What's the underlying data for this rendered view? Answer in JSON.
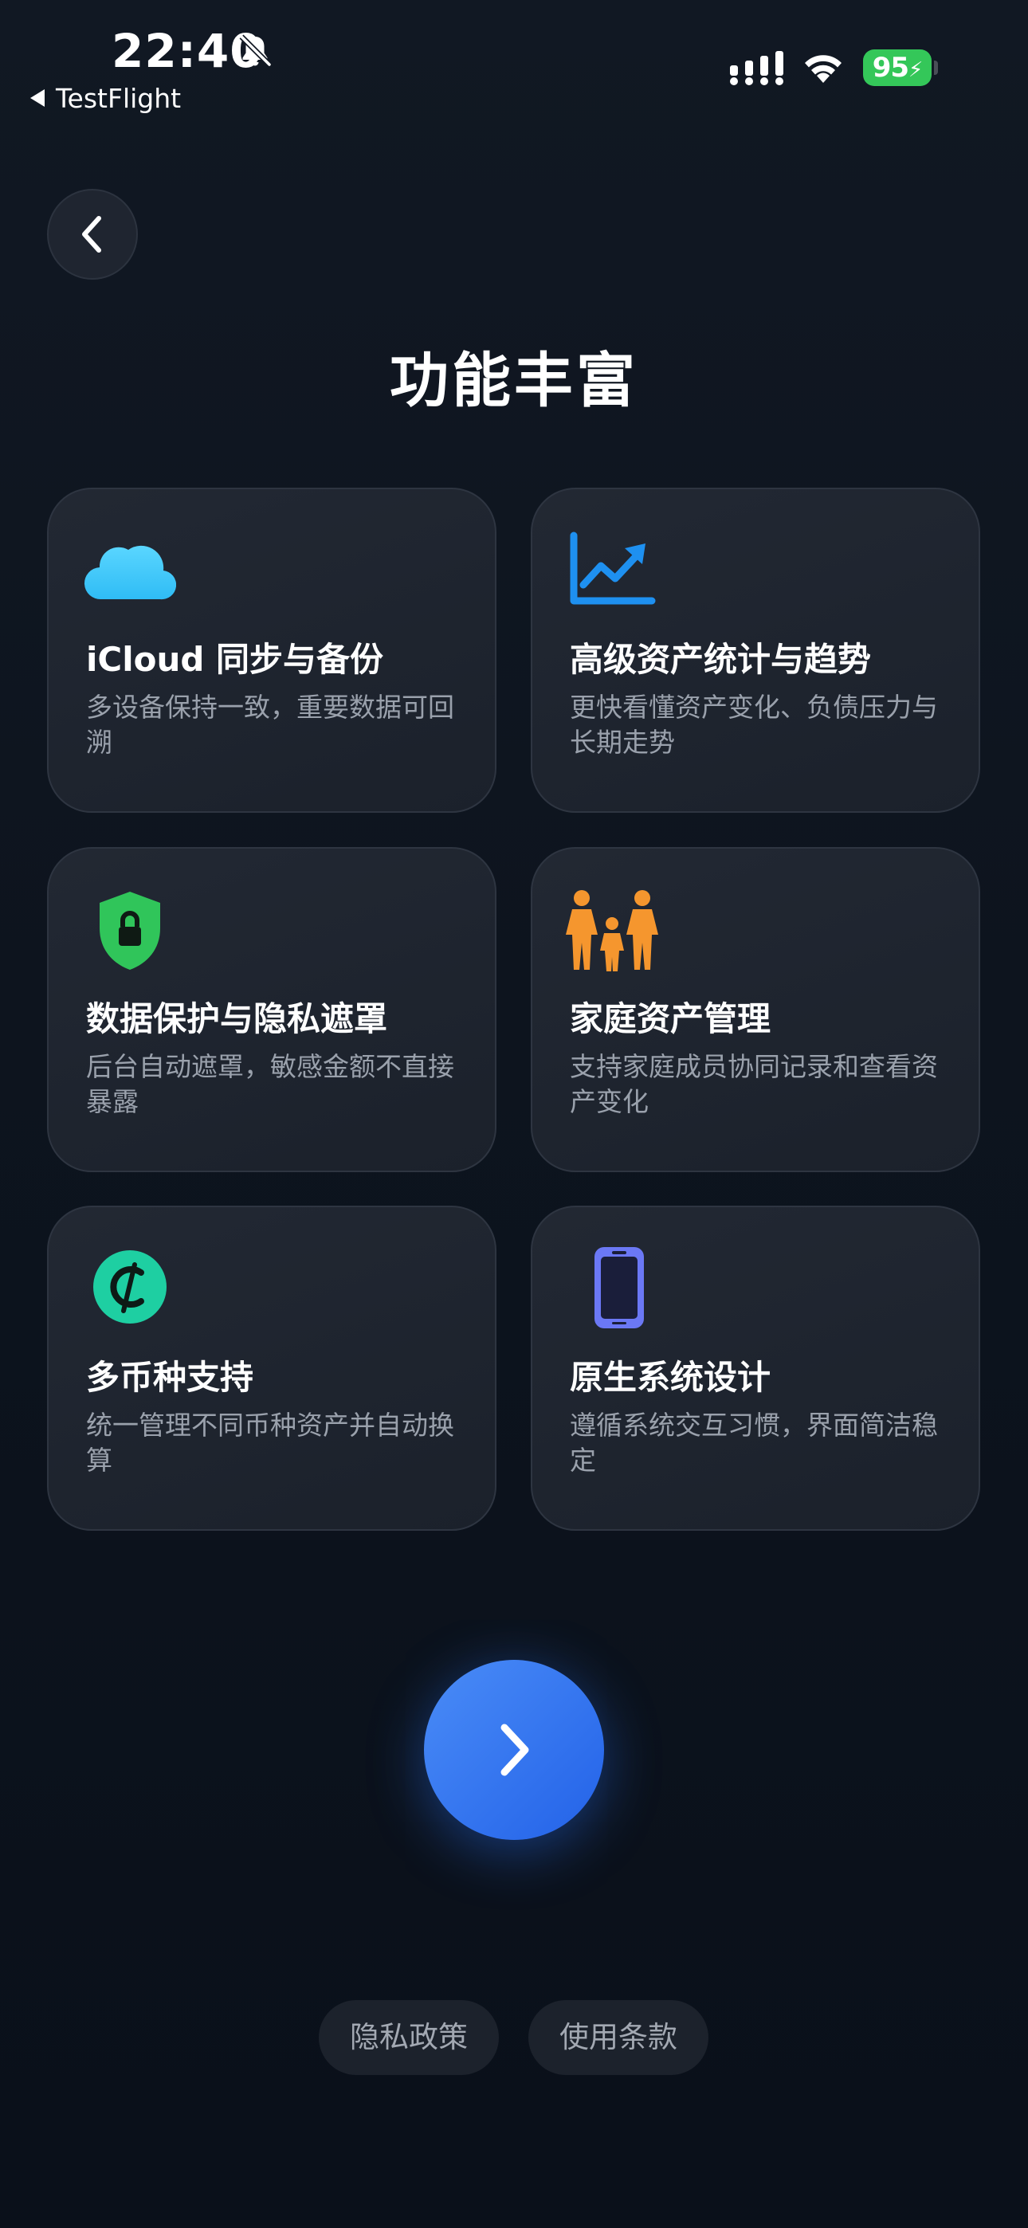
{
  "status_bar": {
    "time": "22:40",
    "back_app": "TestFlight",
    "battery_level": "95"
  },
  "page": {
    "title": "功能丰富"
  },
  "features": [
    {
      "icon": "cloud-icon",
      "icon_color": "#3ec8f8",
      "title": "iCloud 同步与备份",
      "description": "多设备保持一致，重要数据可回溯"
    },
    {
      "icon": "chart-line-uptrend-icon",
      "icon_color": "#1e90f0",
      "title": "高级资产统计与趋势",
      "description": "更快看懂资产变化、负债压力与长期走势"
    },
    {
      "icon": "lock-shield-icon",
      "icon_color": "#30c55a",
      "title": "数据保护与隐私遮罩",
      "description": "后台自动遮罩，敏感金额不直接暴露"
    },
    {
      "icon": "family-icon",
      "icon_color": "#f5962e",
      "title": "家庭资产管理",
      "description": "支持家庭成员协同记录和查看资产变化"
    },
    {
      "icon": "currency-circle-icon",
      "icon_color": "#1ecfa2",
      "title": "多币种支持",
      "description": "统一管理不同币种资产并自动换算"
    },
    {
      "icon": "iphone-icon",
      "icon_color": "#6b78f5",
      "title": "原生系统设计",
      "description": "遵循系统交互习惯，界面简洁稳定"
    }
  ],
  "footer": {
    "privacy_label": "隐私政策",
    "terms_label": "使用条款"
  },
  "colors": {
    "background": "#0f1620",
    "card_background": "#1f252f",
    "next_button": "#3478f6",
    "battery": "#34c759"
  }
}
